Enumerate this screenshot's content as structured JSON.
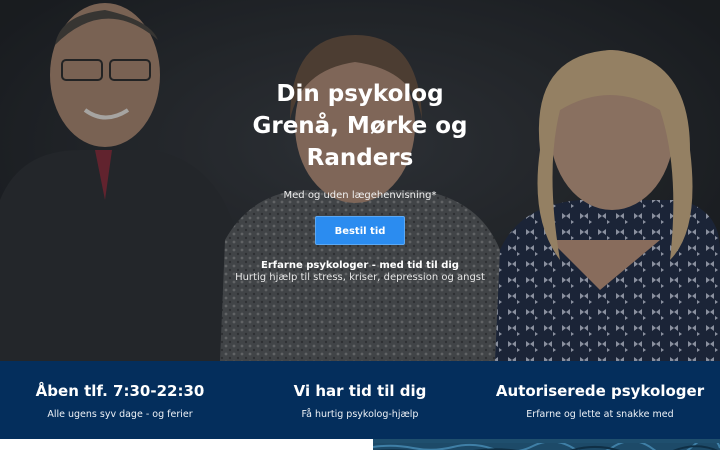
{
  "hero": {
    "title": "Din psykolog\nGrenå, Mørke og\nRanders",
    "subtitle": "Med og uden lægehenvisning*",
    "cta_label": "Bestil tid",
    "tagline": "Erfarne psykologer - med tid til dig",
    "tagline_sub": "Hurtig hjælp til stress, kriser, depression og angst"
  },
  "features": [
    {
      "title": "Åben tlf. 7:30-22:30",
      "desc": "Alle ugens syv dage - og ferier"
    },
    {
      "title": "Vi har tid til dig",
      "desc": "Få hurtig psykolog-hjælp"
    },
    {
      "title": "Autoriserede psykologer",
      "desc": "Erfarne og lette at snakke med"
    }
  ],
  "colors": {
    "hero_bg": "#24272c",
    "cta": "#2b8cf0",
    "features_bg": "#042e5c"
  }
}
